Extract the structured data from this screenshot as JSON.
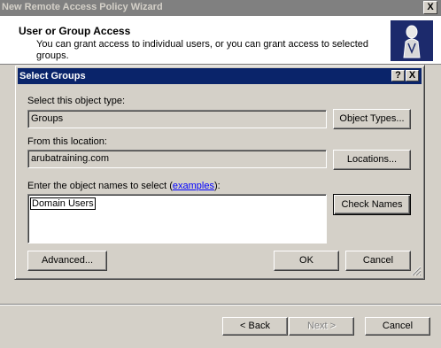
{
  "wizard": {
    "title": "New Remote Access Policy Wizard",
    "close_label": "X",
    "header_title": "User or Group Access",
    "header_description": "You can grant access to individual users, or you can grant access to selected groups.",
    "back_label": "< Back",
    "next_label": "Next >",
    "cancel_label": "Cancel"
  },
  "dialog": {
    "title": "Select Groups",
    "help_label": "?",
    "close_label": "X",
    "object_type_label": "Select this object type:",
    "object_type_value": "Groups",
    "object_types_button": "Object Types...",
    "location_label": "From this location:",
    "location_value": "arubatraining.com",
    "locations_button": "Locations...",
    "names_label_prefix": "Enter the object names to select (",
    "examples_link": "examples",
    "names_label_suffix": "):",
    "names_value": "Domain Users",
    "check_names_button": "Check Names",
    "advanced_button": "Advanced...",
    "ok_button": "OK",
    "cancel_button": "Cancel"
  }
}
